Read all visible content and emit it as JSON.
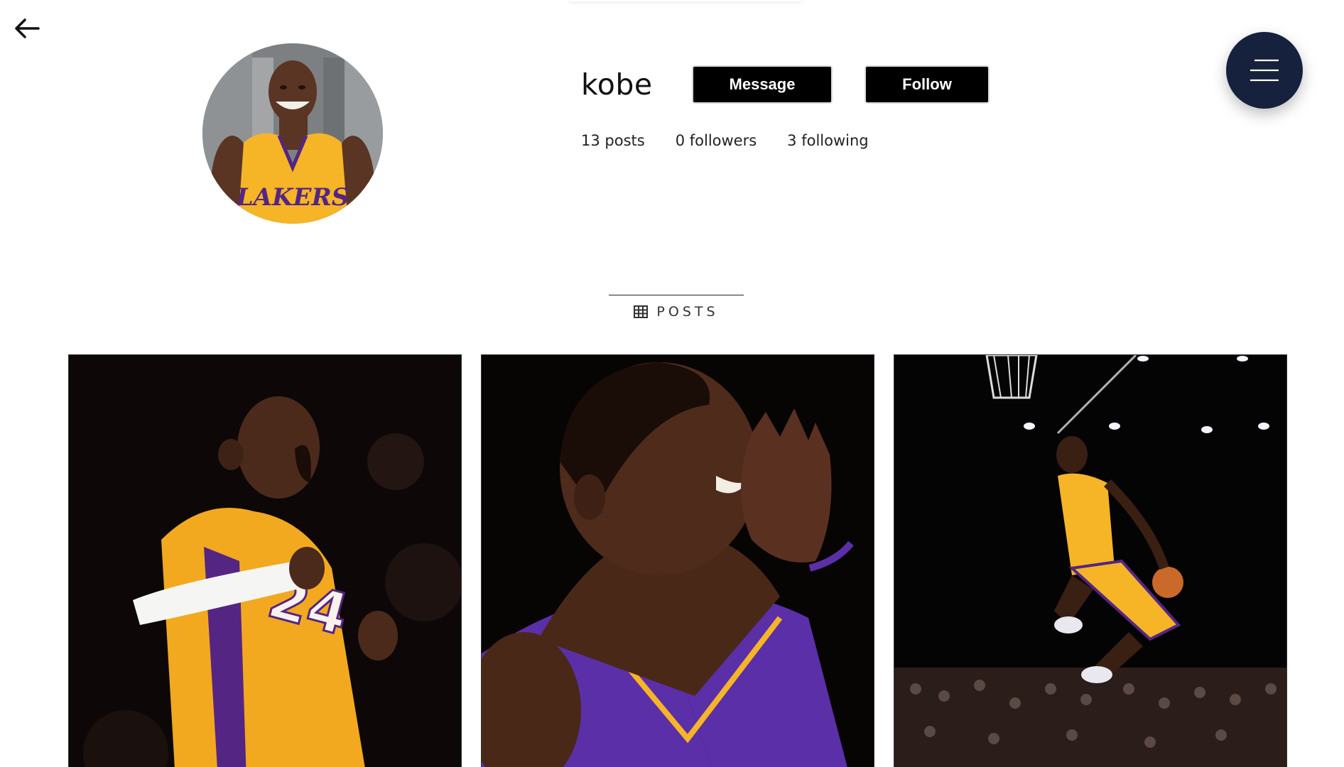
{
  "header": {
    "back_icon": "arrow-left-icon",
    "menu_icon": "hamburger-menu-icon",
    "menu_color": "#16213e"
  },
  "profile": {
    "username": "kobe",
    "message_label": "Message",
    "follow_label": "Follow",
    "posts_count": "13 posts",
    "followers_count": "0 followers",
    "following_count": "3 following"
  },
  "tabs": {
    "posts_label": "POSTS",
    "posts_icon": "grid-icon"
  },
  "colors": {
    "button_bg": "#000000",
    "lakers_gold": "#f5b526",
    "lakers_purple": "#552583"
  }
}
